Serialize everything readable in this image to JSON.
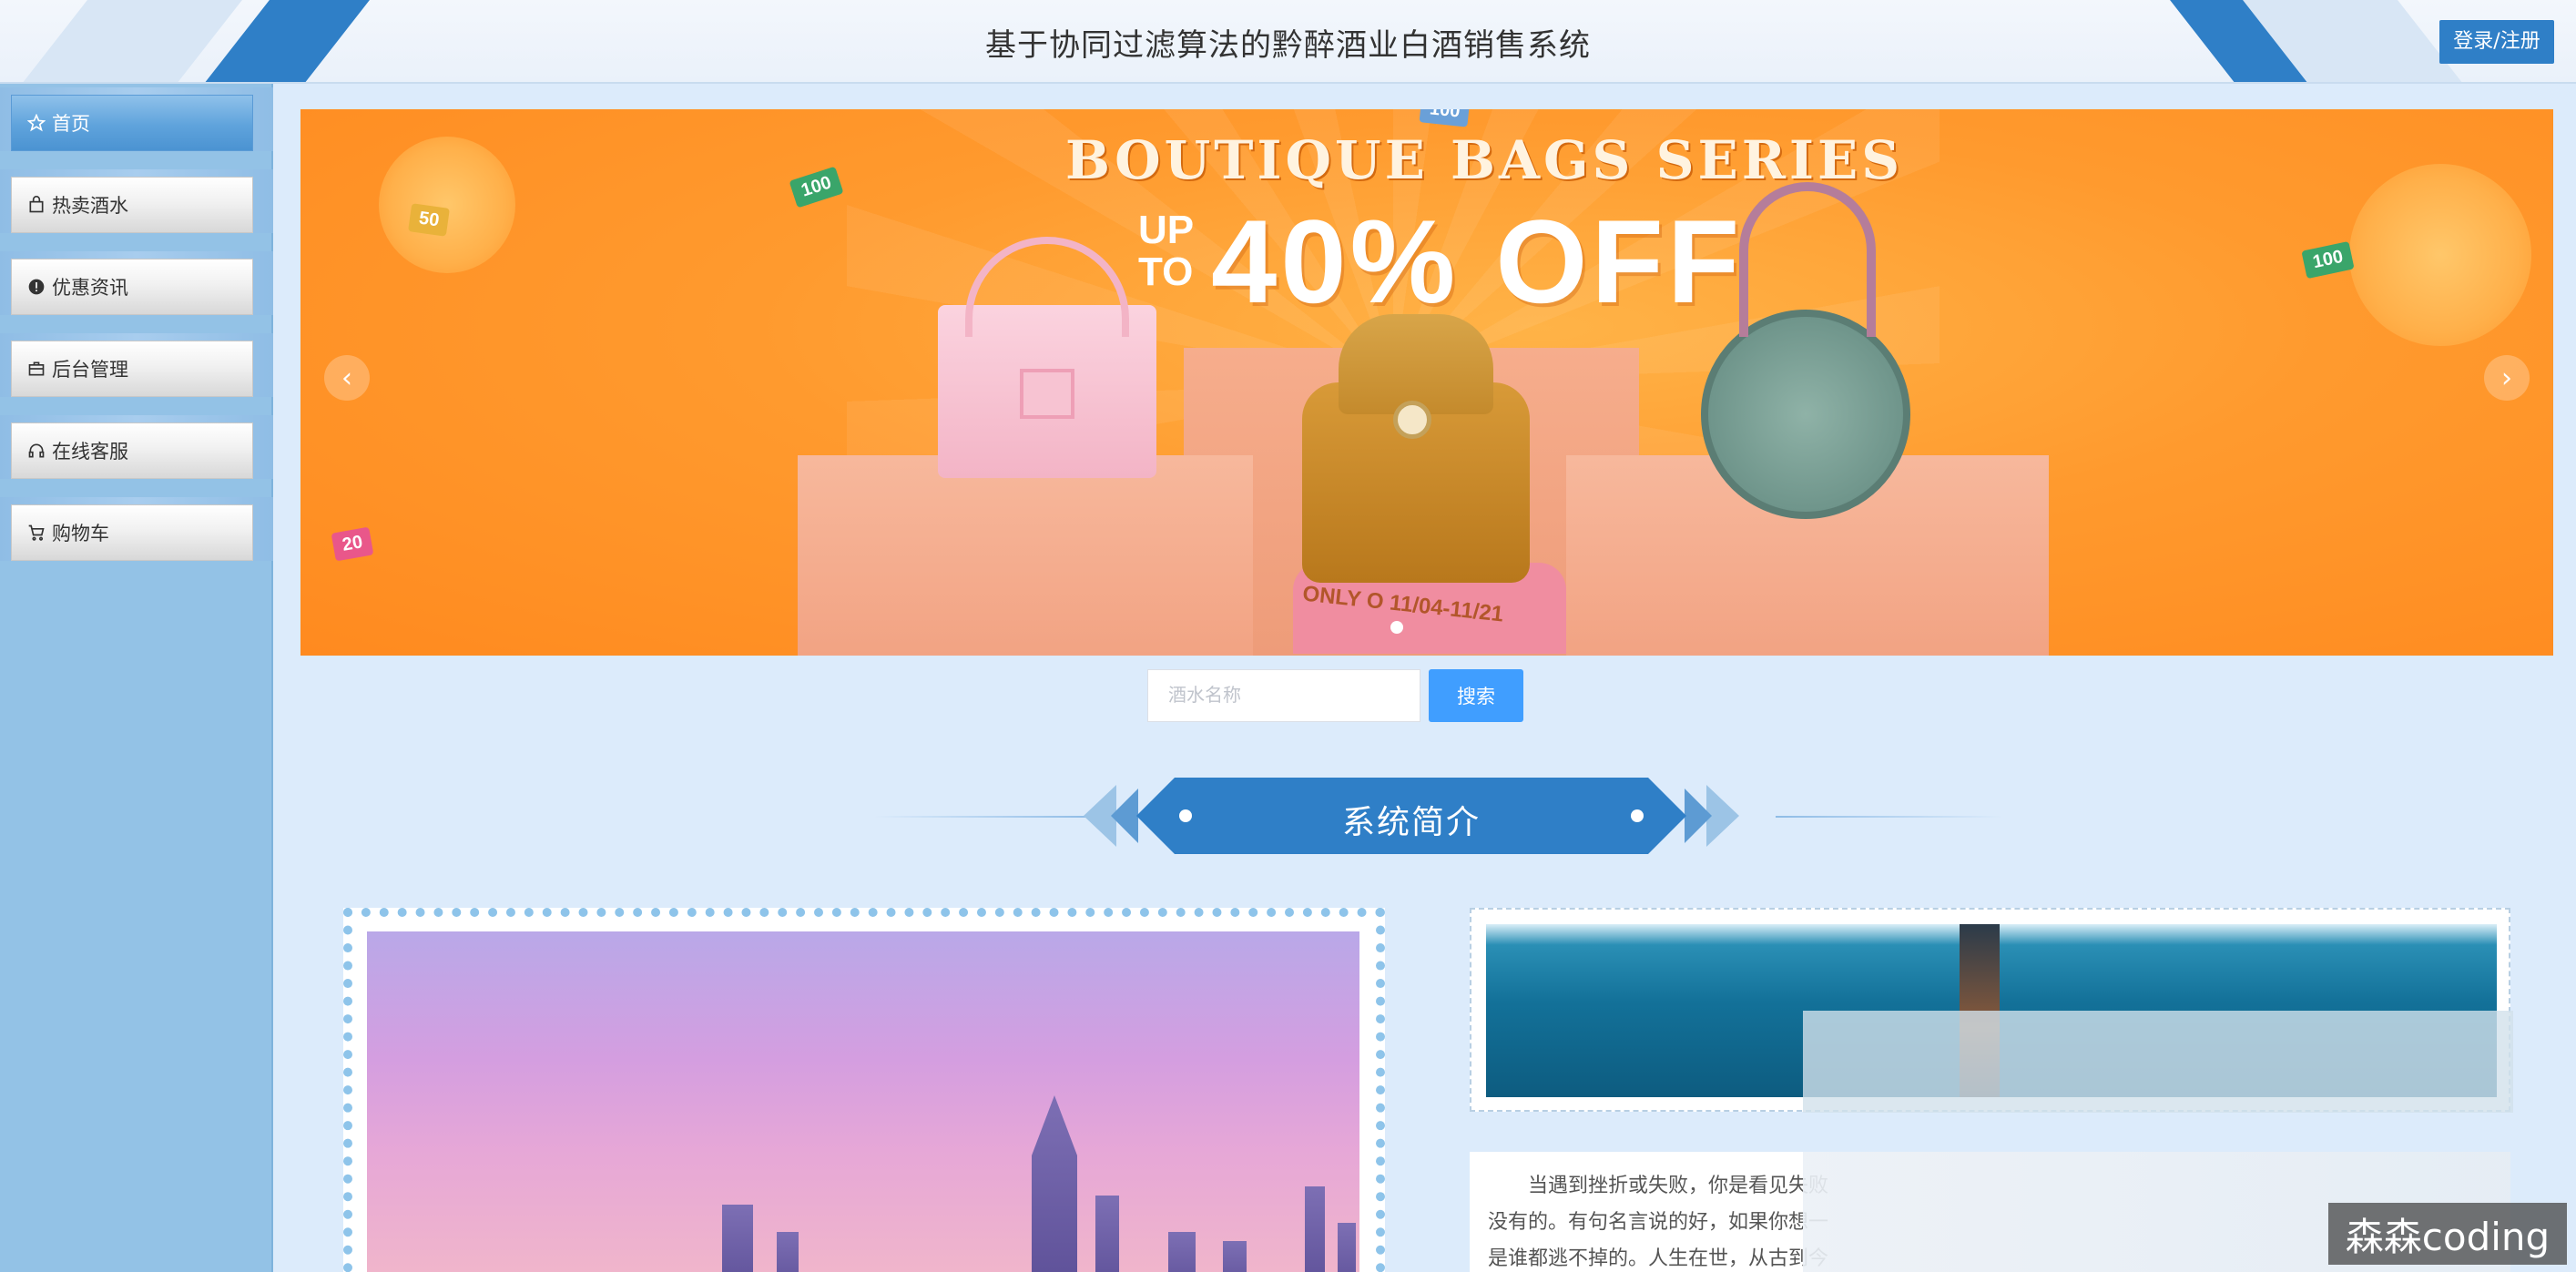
{
  "header": {
    "title": "基于协同过滤算法的黔醉酒业白酒销售系统",
    "login_label": "登录/注册"
  },
  "sidebar": {
    "items": [
      {
        "label": "首页",
        "icon": "star-icon",
        "active": true
      },
      {
        "label": "热卖酒水",
        "icon": "shopping-bag-icon",
        "active": false
      },
      {
        "label": "优惠资讯",
        "icon": "info-circle-icon",
        "active": false
      },
      {
        "label": "后台管理",
        "icon": "briefcase-icon",
        "active": false
      },
      {
        "label": "在线客服",
        "icon": "headset-icon",
        "active": false
      },
      {
        "label": "购物车",
        "icon": "cart-icon",
        "active": false
      }
    ]
  },
  "banner": {
    "headline": "BOUTIQUE BAGS SERIES",
    "up_to": "UP TO",
    "offer": "40% OFF",
    "date": "ONLY O 11/04-11/21",
    "prev_icon": "‹",
    "next_icon": "›",
    "confetti": [
      "100",
      "50",
      "100",
      "20",
      "100"
    ]
  },
  "search": {
    "placeholder": "酒水名称",
    "button_label": "搜索"
  },
  "section": {
    "title": "系统简介"
  },
  "intro": {
    "lines": [
      "当遇到挫折或失败，你是看见失败",
      "没有的。有句名言说的好，如果你想一",
      "是谁都逃不掉的。人生在世，从古到今"
    ]
  },
  "watermark": "森森coding"
}
